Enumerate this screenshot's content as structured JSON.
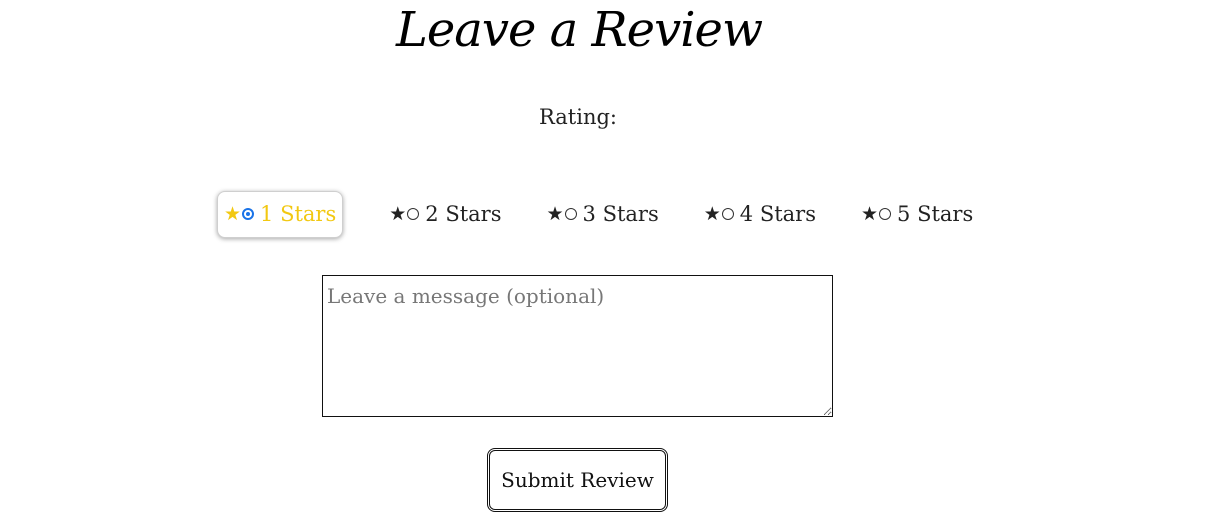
{
  "page": {
    "title": "Leave a Review"
  },
  "rating": {
    "label": "Rating:",
    "selected_value": 1,
    "options": [
      {
        "star_icon": "★",
        "label": "1 Stars",
        "selected": true
      },
      {
        "star_icon": "★",
        "label": "2 Stars",
        "selected": false
      },
      {
        "star_icon": "★",
        "label": "3 Stars",
        "selected": false
      },
      {
        "star_icon": "★",
        "label": "4 Stars",
        "selected": false
      },
      {
        "star_icon": "★",
        "label": "5 Stars",
        "selected": false
      }
    ]
  },
  "message": {
    "value": "",
    "placeholder": "Leave a message (optional)"
  },
  "actions": {
    "submit_label": "Submit Review"
  },
  "colors": {
    "selected_text": "#f2c811",
    "radio_selected": "#1a73e8",
    "text": "#222222"
  }
}
